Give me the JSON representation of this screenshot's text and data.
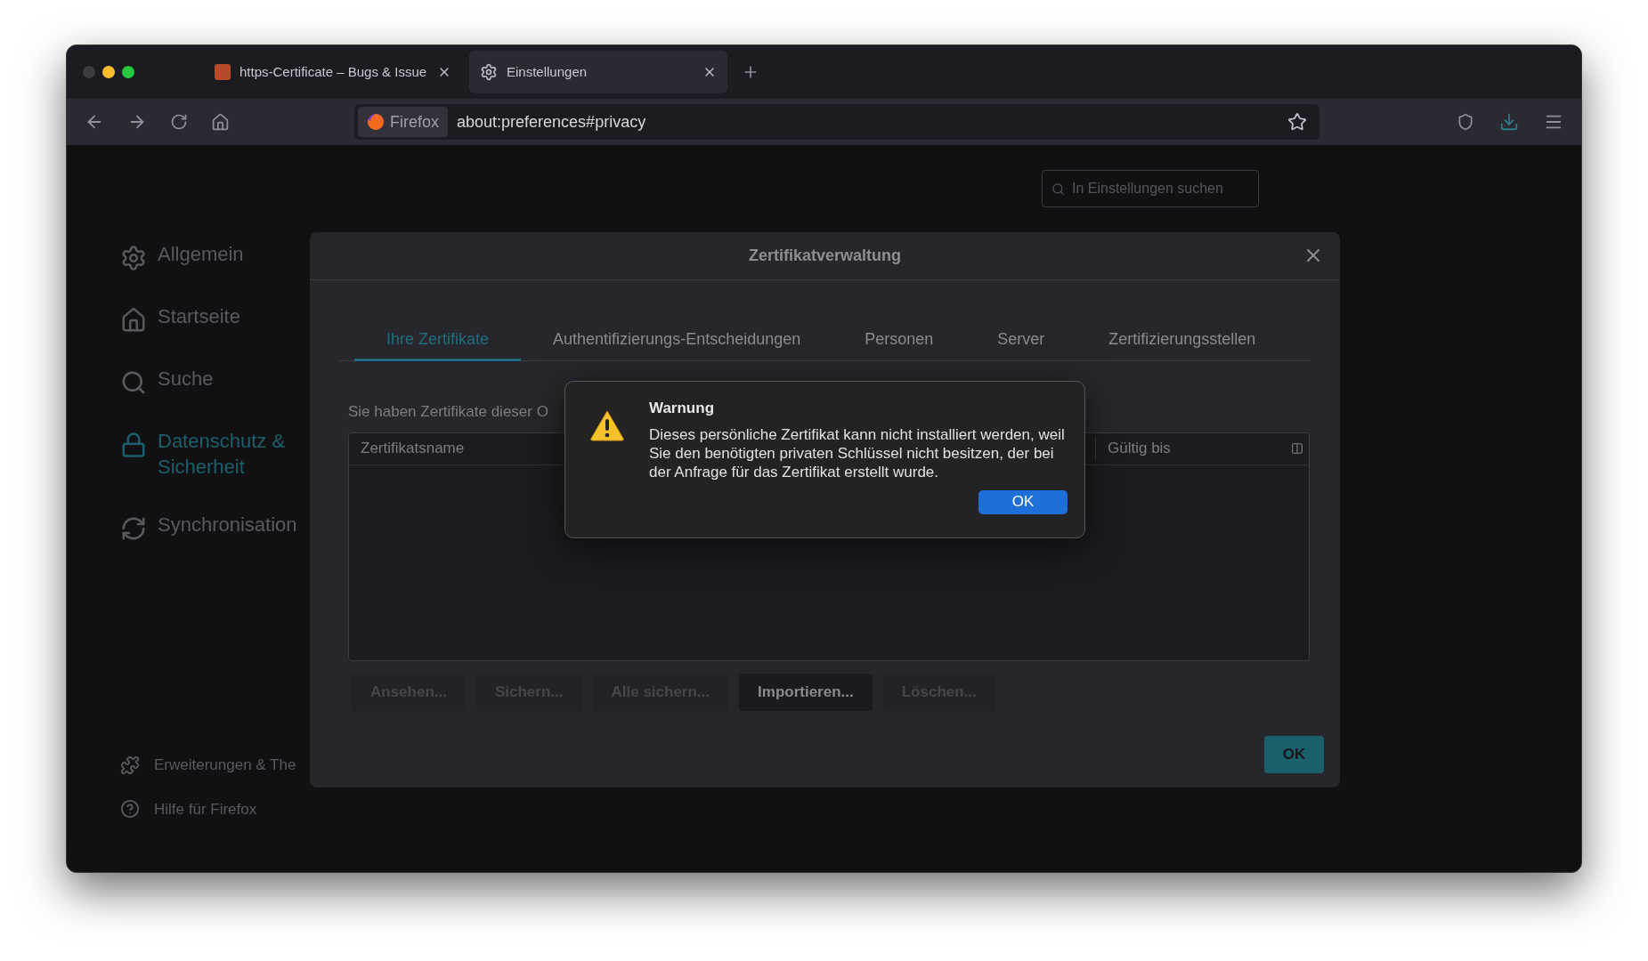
{
  "browser_tabs": [
    {
      "title": "https-Certificate – Bugs & Issue",
      "selected": false
    },
    {
      "title": "Einstellungen",
      "selected": true
    }
  ],
  "address_bar": {
    "identity": "Firefox",
    "url": "about:preferences#privacy"
  },
  "search": {
    "placeholder": "In Einstellungen suchen"
  },
  "sidebar": {
    "items": [
      {
        "label": "Allgemein",
        "kind": "general",
        "selected": false
      },
      {
        "label": "Startseite",
        "kind": "home",
        "selected": false
      },
      {
        "label": "Suche",
        "kind": "search",
        "selected": false
      },
      {
        "label": "Datenschutz & Sicherheit",
        "kind": "privacy",
        "selected": true
      },
      {
        "label": "Synchronisation",
        "kind": "sync",
        "selected": false
      }
    ],
    "footer": [
      {
        "label": "Erweiterungen & The",
        "kind": "addons"
      },
      {
        "label": "Hilfe für Firefox",
        "kind": "help"
      }
    ]
  },
  "dialog": {
    "title": "Zertifikatverwaltung",
    "tabs": [
      {
        "label": "Ihre Zertifikate",
        "selected": true
      },
      {
        "label": "Authentifizierungs-Entscheidungen",
        "selected": false
      },
      {
        "label": "Personen",
        "selected": false
      },
      {
        "label": "Server",
        "selected": false
      },
      {
        "label": "Zertifizierungsstellen",
        "selected": false
      }
    ],
    "description": "Sie haben Zertifikate dieser O",
    "table": {
      "columns": [
        "Zertifikatsname",
        "Gültig bis"
      ]
    },
    "buttons": [
      {
        "label": "Ansehen...",
        "disabled": true
      },
      {
        "label": "Sichern...",
        "disabled": true
      },
      {
        "label": "Alle sichern...",
        "disabled": true
      },
      {
        "label": "Importieren...",
        "disabled": false
      },
      {
        "label": "Löschen...",
        "disabled": true
      }
    ],
    "ok": "OK"
  },
  "alert": {
    "title": "Warnung",
    "message": "Dieses persönliche Zertifikat kann nicht installiert werden, weil Sie den benötigten privaten Schlüssel nicht besitzen, der bei der Anfrage für das Zertifikat erstellt wurde.",
    "button": "OK"
  }
}
